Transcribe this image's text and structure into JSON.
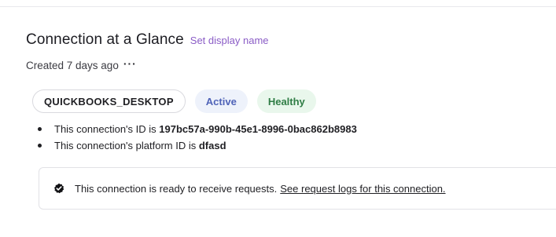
{
  "header": {
    "title": "Connection at a Glance",
    "set_display_name_label": "Set display name",
    "created_text": "Created 7 days ago",
    "more_label": "···"
  },
  "badges": {
    "provider": "QUICKBOOKS_DESKTOP",
    "status": "Active",
    "health": "Healthy"
  },
  "details": {
    "id_prefix": "This connection's ID is",
    "id_value": "197bc57a-990b-45e1-8996-0bac862b8983",
    "platform_prefix": "This connection's platform ID is",
    "platform_value": "dfasd"
  },
  "notice": {
    "icon": "check-circle-icon",
    "text": "This connection is ready to receive requests.",
    "link_label": "See request logs for this connection."
  },
  "colors": {
    "accent_link": "#8a5cc6",
    "status_text": "#4f63b8",
    "status_bg": "#eef2fb",
    "health_text": "#2f7d45",
    "health_bg": "#e9f7ec"
  }
}
